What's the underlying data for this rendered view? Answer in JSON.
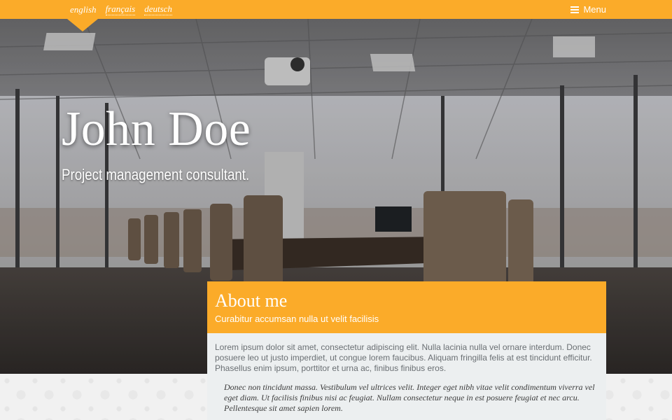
{
  "nav": {
    "languages": [
      {
        "label": "english",
        "active": true
      },
      {
        "label": "français",
        "active": false
      },
      {
        "label": "deutsch",
        "active": false
      }
    ],
    "menu_label": "Menu"
  },
  "hero": {
    "title": "John Doe",
    "subtitle": "Project management consultant."
  },
  "about": {
    "title": "About me",
    "tagline": "Curabitur accumsan nulla ut velit facilisis",
    "paragraph": "Lorem ipsum dolor sit amet, consectetur adipiscing elit. Nulla lacinia nulla vel ornare interdum. Donec posuere leo ut justo imperdiet, ut congue lorem faucibus. Aliquam fringilla felis at est tincidunt efficitur. Phasellus enim ipsum, porttitor et urna ac, finibus finibus eros.",
    "quote": "Donec non tincidunt massa. Vestibulum vel ultrices velit. Integer eget nibh vitae velit condimentum viverra vel eget diam. Ut facilisis finibus nisi ac feugiat. Nullam consectetur neque in est posuere feugiat et nec arcu. Pellentesque sit amet sapien lorem."
  },
  "colors": {
    "accent": "#fbab29",
    "card_body": "#eceff0"
  },
  "icons": {
    "menu": "hamburger-icon"
  }
}
